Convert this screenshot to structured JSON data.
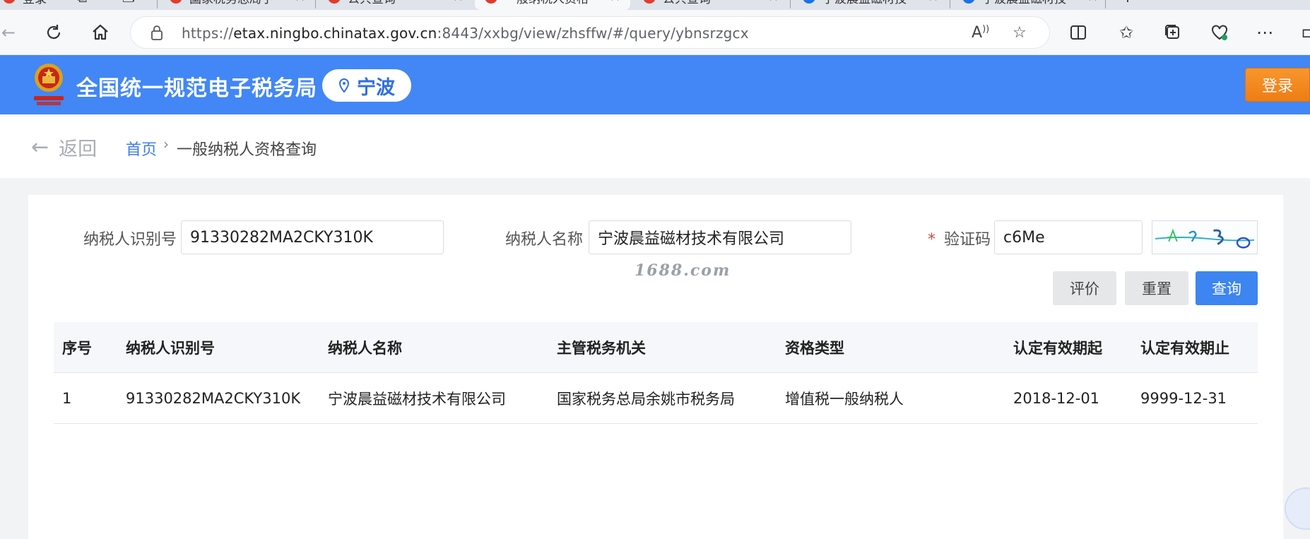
{
  "browser": {
    "tabs": [
      {
        "label": "登录",
        "icon": "red-dot"
      },
      {
        "label": "国家税务总局宁",
        "icon": "tax-bureau-favicon"
      },
      {
        "label": "公共查询",
        "icon": "tax-bureau-favicon"
      },
      {
        "label": "一般纳税人资格",
        "icon": "tax-bureau-favicon"
      },
      {
        "label": "公共查询",
        "icon": "tax-bureau-favicon"
      },
      {
        "label": "宁波晨益磁材技",
        "icon": "search-favicon"
      },
      {
        "label": "宁波晨益磁材技",
        "icon": "search-favicon"
      }
    ],
    "url_scheme": "https://",
    "url_host": "etax.ningbo.chinatax.gov.cn",
    "url_path": ":8443/xxbg/view/zhsffw/#/query/ybnsrzgcx"
  },
  "header": {
    "site_title": "全国统一规范电子税务局",
    "city": "宁波",
    "login_label": "登录",
    "brand_color": "#4287f5"
  },
  "breadcrumb": {
    "back_label": "返回",
    "home_label": "首页",
    "separator": "›",
    "current_label": "一般纳税人资格查询"
  },
  "form": {
    "taxpayer_id_label": "纳税人识别号",
    "taxpayer_id_value": "91330282MA2CKY310K",
    "taxpayer_name_label": "纳税人名称",
    "taxpayer_name_value": "宁波晨益磁材技术有限公司",
    "captcha_required_mark": "*",
    "captcha_label": "验证码",
    "captcha_value": "c6Me",
    "watermark": "1688.com",
    "buttons": {
      "evaluate": "评价",
      "reset": "重置",
      "query": "查询"
    }
  },
  "table": {
    "headers": [
      "序号",
      "纳税人识别号",
      "纳税人名称",
      "主管税务机关",
      "资格类型",
      "认定有效期起",
      "认定有效期止"
    ],
    "rows": [
      [
        "1",
        "91330282MA2CKY310K",
        "宁波晨益磁材技术有限公司",
        "国家税务总局余姚市税务局",
        "增值税一般纳税人",
        "2018-12-01",
        "9999-12-31"
      ]
    ]
  }
}
